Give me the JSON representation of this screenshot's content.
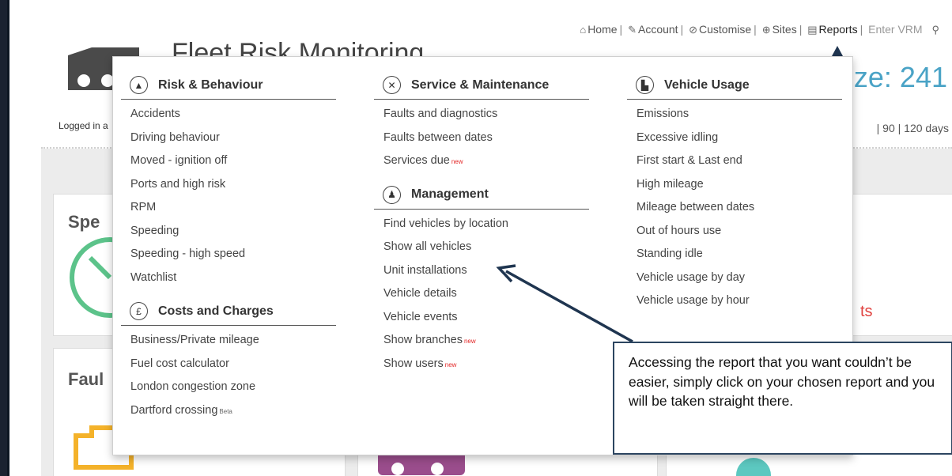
{
  "header": {
    "app_title": "Fleet Risk Monitoring",
    "fleet_size_text": "ize: 241",
    "logged_in_text": "Logged in a",
    "days_text": "| 90 | 120 days"
  },
  "topnav": {
    "home": "Home",
    "account": "Account",
    "customise": "Customise",
    "sites": "Sites",
    "reports": "Reports",
    "enter_vrm": "Enter VRM"
  },
  "cards": {
    "speed_title": "Spe",
    "faults_title": "Faul",
    "right_red_text": "ts"
  },
  "menu": {
    "risk": {
      "title": "Risk & Behaviour",
      "items": [
        "Accidents",
        "Driving behaviour",
        "Moved - ignition off",
        "Ports and high risk",
        "RPM",
        "Speeding",
        "Speeding - high speed",
        "Watchlist"
      ]
    },
    "costs": {
      "title": "Costs and Charges",
      "items": [
        "Business/Private mileage",
        "Fuel cost calculator",
        "London congestion zone",
        "Dartford crossing"
      ],
      "beta_tag": "Beta"
    },
    "service": {
      "title": "Service & Maintenance",
      "items": [
        "Faults and diagnostics",
        "Faults between dates",
        "Services due"
      ]
    },
    "management": {
      "title": "Management",
      "items": [
        "Find vehicles by location",
        "Show all vehicles",
        "Unit installations",
        "Vehicle details",
        "Vehicle events",
        "Show branches",
        "Show users"
      ]
    },
    "usage": {
      "title": "Vehicle Usage",
      "items": [
        "Emissions",
        "Excessive idling",
        "First start & Last end",
        "High mileage",
        "Mileage between dates",
        "Out of hours use",
        "Standing idle",
        "Vehicle usage by day",
        "Vehicle usage by hour"
      ]
    },
    "new_tag": "new"
  },
  "callout_text": "Accessing the report that you want couldn’t be easier, simply click on your chosen report and you will be taken straight there.",
  "colors": {
    "accent_blue": "#4aa3c6",
    "new_red": "#e32626",
    "callout_border": "#2c4560",
    "gauge_green": "#5cc38a",
    "engine_orange": "#f4b22a"
  }
}
